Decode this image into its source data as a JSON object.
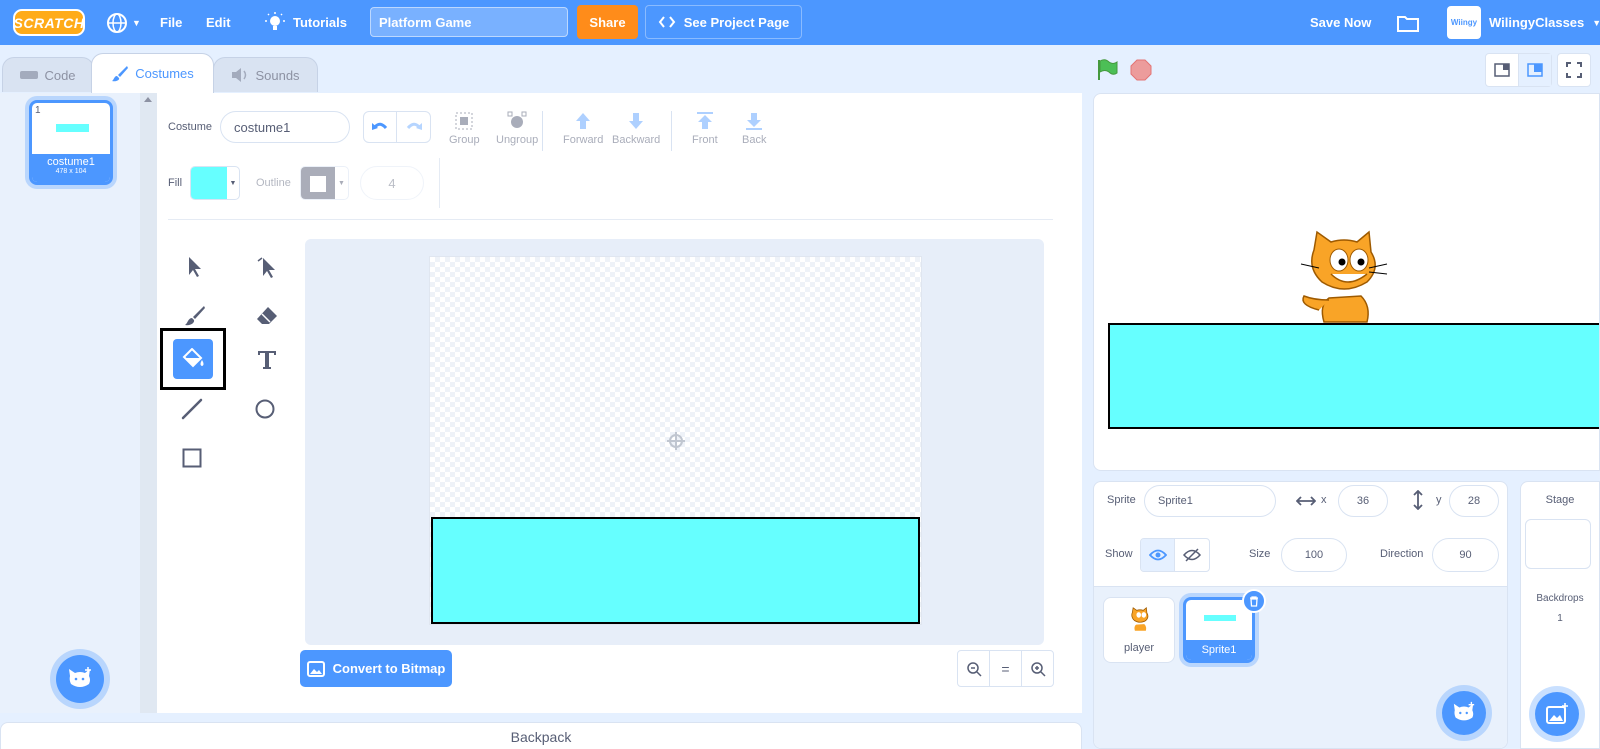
{
  "menubar": {
    "logo": "SCRATCH",
    "file": "File",
    "edit": "Edit",
    "tutorials": "Tutorials",
    "project_title": "Platform Game",
    "share": "Share",
    "see_project_page": "See Project Page",
    "save_now": "Save Now",
    "username": "WilingyClasses",
    "avatar_text": "Wiingy"
  },
  "tabs": {
    "code": "Code",
    "costumes": "Costumes",
    "sounds": "Sounds"
  },
  "costume_list": {
    "items": [
      {
        "number": "1",
        "name": "costume1",
        "size": "478 x 104"
      }
    ]
  },
  "paint_editor": {
    "costume_label": "Costume",
    "costume_name": "costume1",
    "actions": {
      "group": "Group",
      "ungroup": "Ungroup",
      "forward": "Forward",
      "backward": "Backward",
      "front": "Front",
      "back": "Back"
    },
    "fill_label": "Fill",
    "fill_color": "#66ffff",
    "outline_label": "Outline",
    "outline_width": "4",
    "convert_button": "Convert to Bitmap",
    "zoom_reset": "="
  },
  "backpack": "Backpack",
  "sprite_info": {
    "sprite_label": "Sprite",
    "sprite_name": "Sprite1",
    "x_label": "x",
    "x_value": "36",
    "y_label": "y",
    "y_value": "28",
    "show_label": "Show",
    "size_label": "Size",
    "size_value": "100",
    "direction_label": "Direction",
    "direction_value": "90",
    "sprites": [
      {
        "name": "player"
      },
      {
        "name": "Sprite1"
      }
    ]
  },
  "stage_panel": {
    "title": "Stage",
    "backdrops_label": "Backdrops",
    "backdrops_count": "1"
  },
  "colors": {
    "accent": "#4c97ff",
    "platform": "#66ffff",
    "share": "#ff8c1a"
  }
}
